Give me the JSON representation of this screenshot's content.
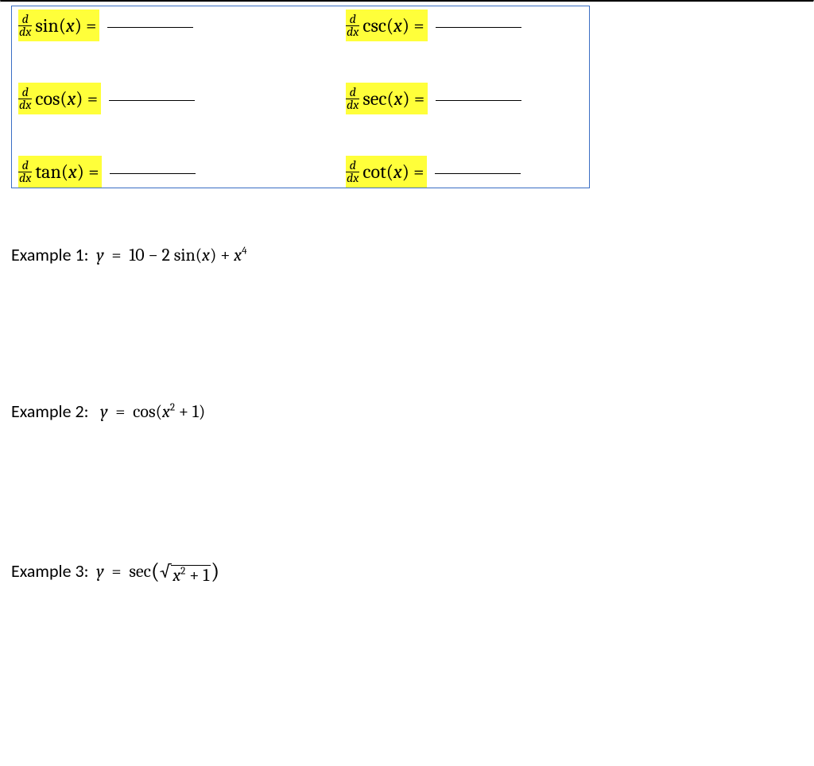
{
  "derivatives": {
    "rows": [
      {
        "left": {
          "num": "d",
          "den": "dx",
          "fn": "sin",
          "arg": "x"
        },
        "right": {
          "num": "d",
          "den": "dx",
          "fn": "csc",
          "arg": "x"
        }
      },
      {
        "left": {
          "num": "d",
          "den": "dx",
          "fn": "cos",
          "arg": "x"
        },
        "right": {
          "num": "d",
          "den": "dx",
          "fn": "sec",
          "arg": "x"
        }
      },
      {
        "left": {
          "num": "d",
          "den": "dx",
          "fn": "tan",
          "arg": "x"
        },
        "right": {
          "num": "d",
          "den": "dx",
          "fn": "cot",
          "arg": "x"
        }
      }
    ],
    "equals": "="
  },
  "examples": {
    "ex1": {
      "label": "Example 1:",
      "y": "y",
      "eq": "=",
      "rhs_plain1": "10 − 2 ",
      "fn1": "sin",
      "arg1": "x",
      "rhs_plain2": " + ",
      "var2": "x",
      "exp2": "4"
    },
    "ex2": {
      "label": "Example 2:",
      "y": "y",
      "eq": "=",
      "fn": "cos",
      "inner_var": "x",
      "inner_exp": "2",
      "inner_tail": " + 1"
    },
    "ex3": {
      "label": "Example 3:",
      "y": "y",
      "eq": "=",
      "fn": "sec",
      "rad_var": "x",
      "rad_exp": "2",
      "rad_tail": " + 1"
    }
  }
}
